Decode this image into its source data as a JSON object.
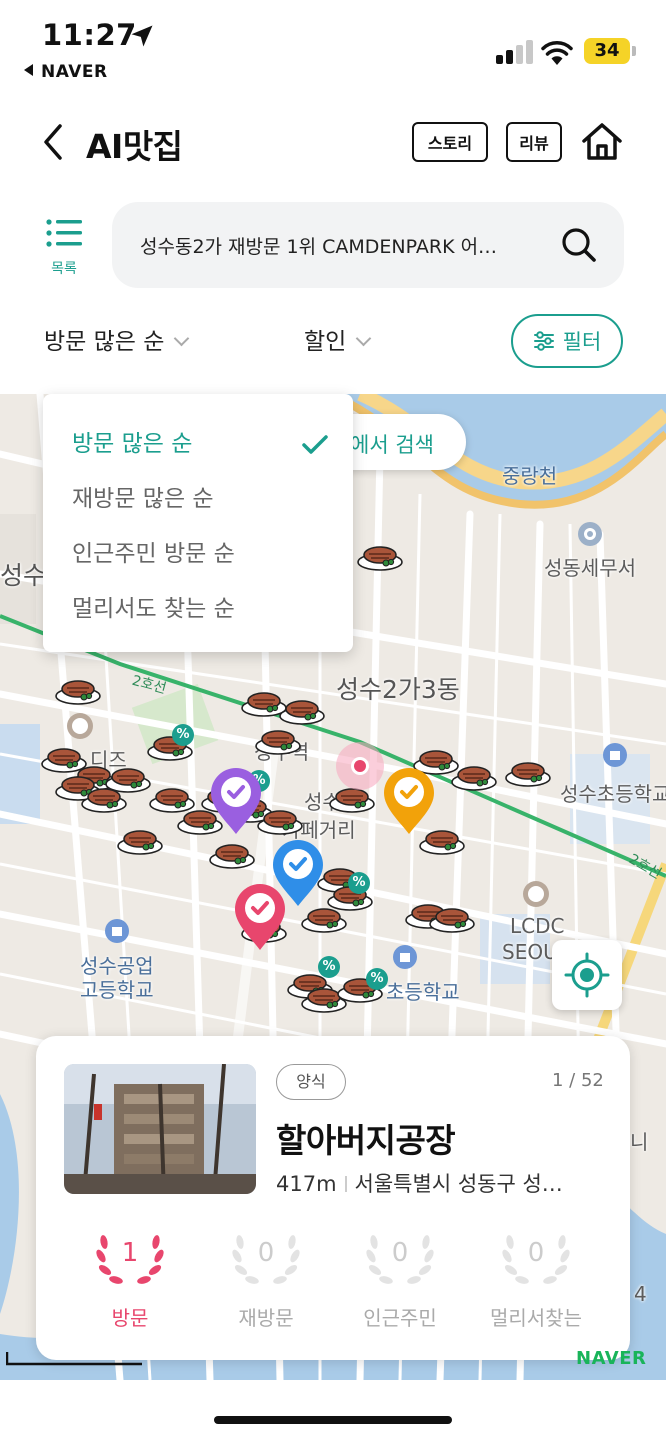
{
  "status_bar": {
    "time": "11:27",
    "back_app": "NAVER",
    "battery": "34"
  },
  "header": {
    "title": "AI맛집",
    "story_label": "스토리",
    "review_label": "리뷰"
  },
  "search": {
    "list_label": "목록",
    "query": "성수동2가 재방문 1위 CAMDENPARK 어…"
  },
  "filters": {
    "sort_label": "방문 많은 순",
    "discount_label": "할인",
    "filter_label": "필터"
  },
  "sort_menu": {
    "options": [
      "방문 많은 순",
      "재방문 많은 순",
      "인근주민 방문 순",
      "멀리서도 찾는 순"
    ],
    "selected_index": 0
  },
  "map": {
    "research_label": "에서 검색",
    "labels": {
      "junglangcheon": "중랑천",
      "seongdong_tax": "성동세무서",
      "seongsu_left": "성수",
      "seongsu2ga3": "성수2가3동",
      "station": "성수역",
      "cafe_street_1": "성수",
      "cafe_street_2": "카페거리",
      "dize": "디즈",
      "line2_a": "2호선",
      "line2_b": "2호선",
      "elementary": "성수초등학교",
      "lcdc": "LCDC",
      "seoul": "SEOUL",
      "technical_high_1": "성수공업",
      "technical_high_2": "고등학교",
      "elementary2": "초등학교",
      "ni": "니",
      "number4": "4"
    },
    "naver_logo": "NAVER"
  },
  "card": {
    "category": "양식",
    "page_count": "1 / 52",
    "name": "할아버지공장",
    "distance": "417m",
    "address": "서울특별시 성동구 성…",
    "stats": [
      {
        "value": "1",
        "label": "방문"
      },
      {
        "value": "0",
        "label": "재방문"
      },
      {
        "value": "0",
        "label": "인근주민"
      },
      {
        "value": "0",
        "label": "멀리서찾는"
      }
    ]
  },
  "colors": {
    "accent": "#1b9e8e",
    "active_stat": "#e8466d",
    "pin_purple": "#9a5fe0",
    "pin_orange": "#f2a20a",
    "pin_blue": "#2f8ee8",
    "pin_pink": "#e8466d",
    "river": "#a9cbe8"
  }
}
